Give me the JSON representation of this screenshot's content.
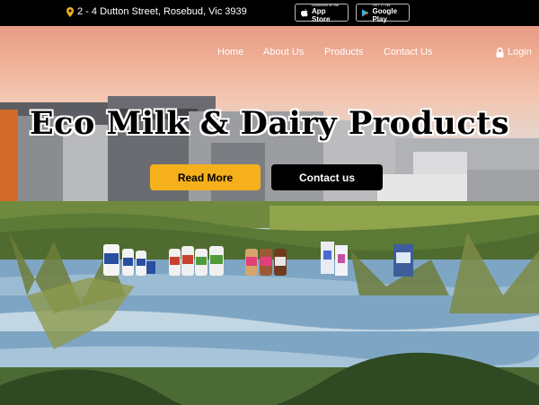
{
  "topbar": {
    "address": "2 - 4 Dutton Street, Rosebud, Vic 3939",
    "app_store": {
      "small": "Download on the",
      "big": "App Store"
    },
    "google_play": {
      "small": "GET IT ON",
      "big": "Google Play"
    }
  },
  "nav": {
    "items": [
      "Home",
      "About Us",
      "Products",
      "Contact Us"
    ],
    "login": "Login"
  },
  "hero": {
    "title": "Eco Milk & Dairy Products",
    "read_more": "Read More",
    "contact": "Contact us"
  },
  "colors": {
    "accent": "#f5b01c",
    "topbar": "#000000",
    "pin": "#f5b01c"
  }
}
